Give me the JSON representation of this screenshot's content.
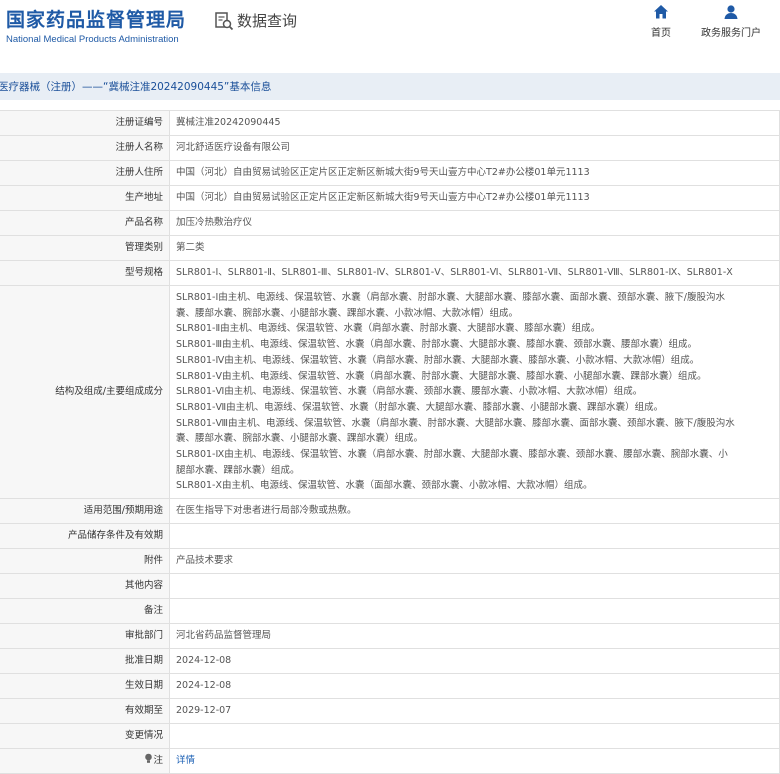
{
  "header": {
    "logo_cn": "国家药品监督管理局",
    "logo_en": "National Medical Products Administration",
    "search_label": "数据查询",
    "nav": [
      {
        "label": "首页",
        "icon": "home-icon"
      },
      {
        "label": "政务服务门户",
        "icon": "user-icon"
      }
    ]
  },
  "breadcrumb": "医疗器械（注册）——“冀械注准20242090445”基本信息",
  "rows": {
    "reg_no": {
      "label": "注册证编号",
      "value": "冀械注准20242090445"
    },
    "registrant": {
      "label": "注册人名称",
      "value": "河北舒适医疗设备有限公司"
    },
    "registrant_addr": {
      "label": "注册人住所",
      "value": "中国（河北）自由贸易试验区正定片区正定新区新城大街9号天山壹方中心T2#办公楼01单元1113"
    },
    "production_addr": {
      "label": "生产地址",
      "value": "中国（河北）自由贸易试验区正定片区正定新区新城大街9号天山壹方中心T2#办公楼01单元1113"
    },
    "product_name": {
      "label": "产品名称",
      "value": "加压冷热敷治疗仪"
    },
    "category": {
      "label": "管理类别",
      "value": "第二类"
    },
    "models": {
      "label": "型号规格",
      "value": "SLR801-Ⅰ、SLR801-Ⅱ、SLR801-Ⅲ、SLR801-Ⅳ、SLR801-Ⅴ、SLR801-Ⅵ、SLR801-Ⅶ、SLR801-Ⅷ、SLR801-Ⅸ、SLR801-Ⅹ"
    },
    "structure": {
      "label": "结构及组成/主要组成成分",
      "lines": [
        "SLR801-Ⅰ由主机、电源线、保温软管、水囊（肩部水囊、肘部水囊、大腿部水囊、膝部水囊、面部水囊、颈部水囊、腋下/腹股沟水",
        "囊、腰部水囊、腕部水囊、小腿部水囊、踝部水囊、小款冰帽、大款冰帽）组成。",
        "SLR801-Ⅱ由主机、电源线、保温软管、水囊（肩部水囊、肘部水囊、大腿部水囊、膝部水囊）组成。",
        "SLR801-Ⅲ由主机、电源线、保温软管、水囊（肩部水囊、肘部水囊、大腿部水囊、膝部水囊、颈部水囊、腰部水囊）组成。",
        "SLR801-Ⅳ由主机、电源线、保温软管、水囊（肩部水囊、肘部水囊、大腿部水囊、膝部水囊、小款冰帽、大款冰帽）组成。",
        "SLR801-Ⅴ由主机、电源线、保温软管、水囊（肩部水囊、肘部水囊、大腿部水囊、膝部水囊、小腿部水囊、踝部水囊）组成。",
        "SLR801-Ⅵ由主机、电源线、保温软管、水囊（肩部水囊、颈部水囊、腰部水囊、小款冰帽、大款冰帽）组成。",
        "SLR801-Ⅶ由主机、电源线、保温软管、水囊（肘部水囊、大腿部水囊、膝部水囊、小腿部水囊、踝部水囊）组成。",
        "SLR801-Ⅷ由主机、电源线、保温软管、水囊（肩部水囊、肘部水囊、大腿部水囊、膝部水囊、面部水囊、颈部水囊、腋下/腹股沟水",
        "囊、腰部水囊、腕部水囊、小腿部水囊、踝部水囊）组成。",
        "SLR801-Ⅸ由主机、电源线、保温软管、水囊（肩部水囊、肘部水囊、大腿部水囊、膝部水囊、颈部水囊、腰部水囊、腕部水囊、小",
        "腿部水囊、踝部水囊）组成。",
        "SLR801-Ⅹ由主机、电源线、保温软管、水囊（面部水囊、颈部水囊、小款冰帽、大款冰帽）组成。"
      ]
    },
    "scope": {
      "label": "适用范围/预期用途",
      "value": "在医生指导下对患者进行局部冷敷或热敷。"
    },
    "storage": {
      "label": "产品储存条件及有效期",
      "value": ""
    },
    "attachment": {
      "label": "附件",
      "value": "产品技术要求"
    },
    "other": {
      "label": "其他内容",
      "value": ""
    },
    "remark": {
      "label": "备注",
      "value": ""
    },
    "approver": {
      "label": "审批部门",
      "value": "河北省药品监督管理局"
    },
    "approval_date": {
      "label": "批准日期",
      "value": "2024-12-08"
    },
    "issue_date": {
      "label": "生效日期",
      "value": "2024-12-08"
    },
    "expiry": {
      "label": "有效期至",
      "value": "2029-12-07"
    },
    "changes": {
      "label": "变更情况",
      "value": ""
    },
    "note": {
      "label": "注",
      "icon": "bulb-icon",
      "value": "详情"
    }
  }
}
